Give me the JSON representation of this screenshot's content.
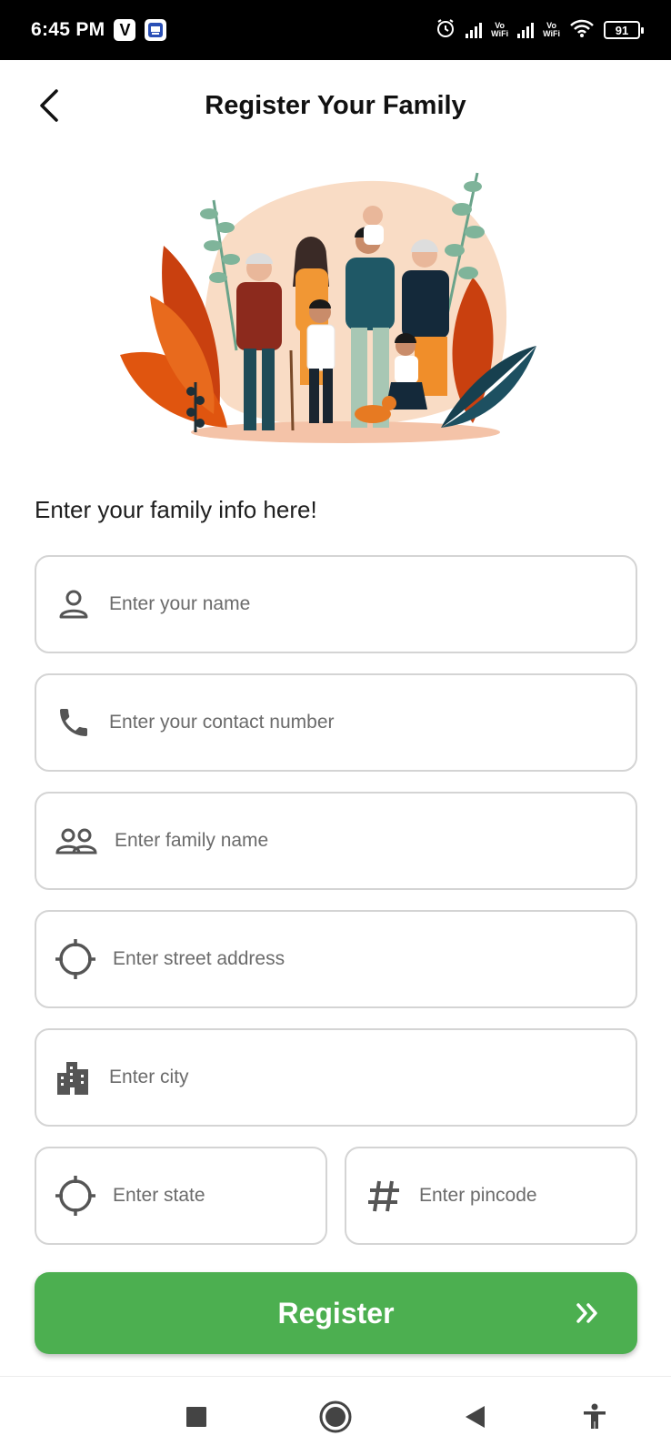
{
  "status_bar": {
    "time": "6:45 PM",
    "app_badge_1": "V",
    "battery": "91",
    "vo_wifi_1": "Vo\nWiFi",
    "vo_wifi_2": "Vo\nWiFi"
  },
  "header": {
    "title": "Register Your Family",
    "back_icon": "arrow-left-icon"
  },
  "form": {
    "intro": "Enter your family info here!",
    "fields": {
      "name": {
        "placeholder": "Enter your name",
        "value": "",
        "icon": "person-icon"
      },
      "contact": {
        "placeholder": "Enter your contact number",
        "value": "",
        "icon": "phone-icon"
      },
      "family_name": {
        "placeholder": "Enter family name",
        "value": "",
        "icon": "group-icon"
      },
      "street": {
        "placeholder": "Enter street address",
        "value": "",
        "icon": "crosshair-icon"
      },
      "city": {
        "placeholder": "Enter city",
        "value": "",
        "icon": "city-icon"
      },
      "state": {
        "placeholder": "Enter state",
        "value": "",
        "icon": "crosshair-icon"
      },
      "pincode": {
        "placeholder": "Enter pincode",
        "value": "",
        "icon": "hash-icon"
      }
    },
    "submit_label": "Register",
    "submit_icon": "double-chevron-right-icon"
  },
  "colors": {
    "accent": "#4caf50",
    "border": "#d4d4d4",
    "icon": "#555555"
  },
  "nav_bar": {
    "recents_icon": "square-icon",
    "home_icon": "circle-home-icon",
    "back_icon": "triangle-back-icon",
    "accessibility_icon": "accessibility-icon"
  }
}
